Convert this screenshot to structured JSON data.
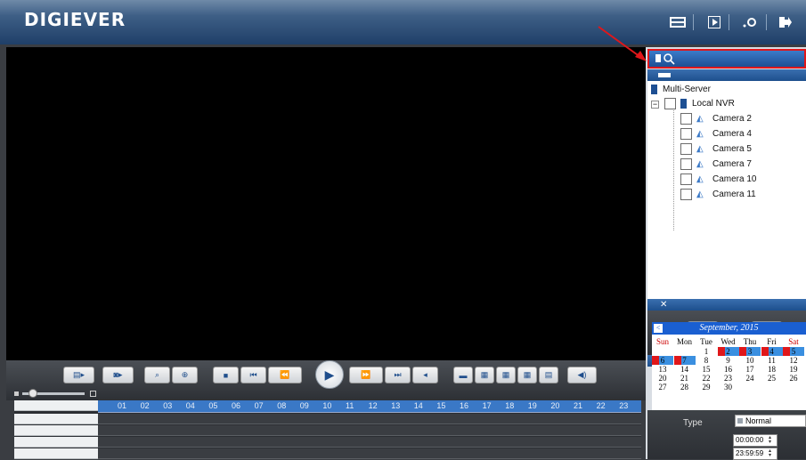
{
  "app": {
    "brand": "DIGIEVER"
  },
  "controls": {
    "button_icons": [
      "layout-icon",
      "snapshot-icon",
      "search-icon",
      "zoom-in-icon",
      "stop-icon",
      "prev-frame-icon",
      "rewind-icon",
      "fast-forward-icon",
      "next-frame-icon",
      "back-icon",
      "single-view-icon",
      "quad-view-icon",
      "nine-view-icon",
      "sixteen-view-icon",
      "custom-view-icon",
      "volume-icon"
    ]
  },
  "timeline": {
    "hours": [
      "01",
      "02",
      "03",
      "04",
      "05",
      "06",
      "07",
      "08",
      "09",
      "10",
      "11",
      "12",
      "13",
      "14",
      "15",
      "16",
      "17",
      "18",
      "19",
      "20",
      "21",
      "22",
      "23"
    ]
  },
  "tree": {
    "root": "Multi-Server",
    "nvr": "Local NVR",
    "cameras": [
      "Camera 2",
      "Camera 4",
      "Camera 5",
      "Camera 7",
      "Camera 10",
      "Camera 11"
    ]
  },
  "calendar": {
    "title": "September, 2015",
    "days_of_week": [
      "Sun",
      "Mon",
      "Tue",
      "Wed",
      "Thu",
      "Fri",
      "Sat"
    ],
    "weeks": [
      [
        "",
        "",
        "1",
        "2",
        "3",
        "4",
        "5"
      ],
      [
        "6",
        "7",
        "8",
        "9",
        "10",
        "11",
        "12"
      ],
      [
        "13",
        "14",
        "15",
        "16",
        "17",
        "18",
        "19"
      ],
      [
        "20",
        "21",
        "22",
        "23",
        "24",
        "25",
        "26"
      ],
      [
        "27",
        "28",
        "29",
        "30",
        "",
        "",
        ""
      ]
    ],
    "highlighted_red": [
      "2",
      "3",
      "4",
      "5",
      "6",
      "7"
    ],
    "colors": {
      "header": "#1a5fd1",
      "marker": "#e0171a",
      "selected": "#3a8fe0"
    }
  },
  "filter": {
    "type_label": "Type",
    "type_value": "Normal",
    "start_time": "00:00:00",
    "end_time": "23:59:59"
  },
  "colors": {
    "accent": "#1d4f93",
    "highlight_border": "#e0171a"
  }
}
